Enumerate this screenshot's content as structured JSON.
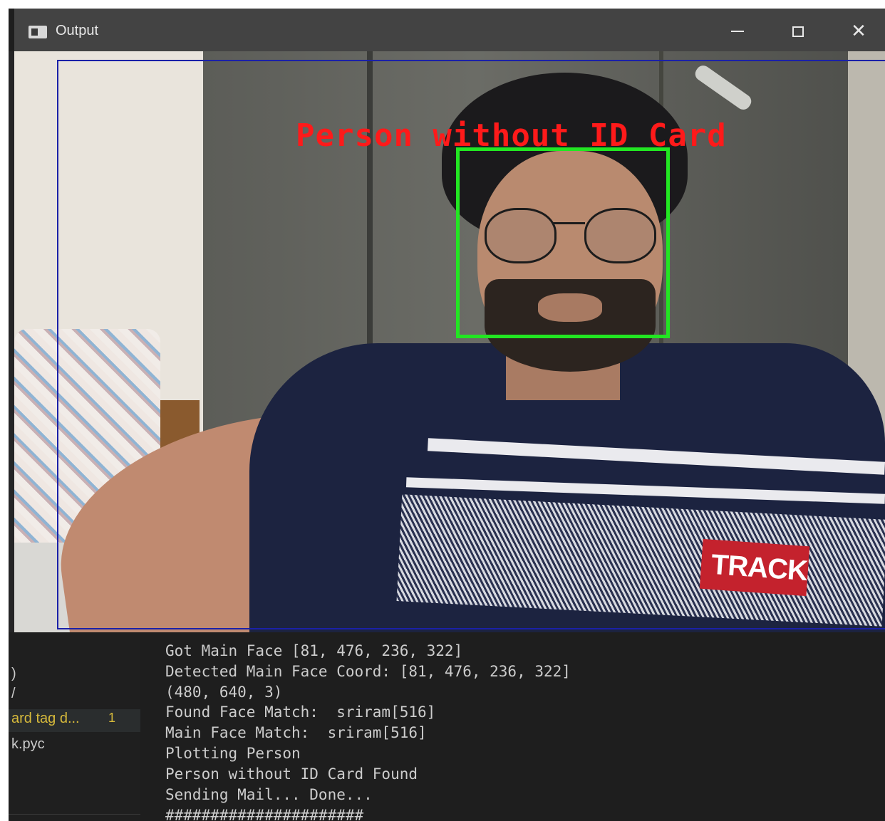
{
  "window": {
    "title": "Output",
    "controls": {
      "minimize": "minimize",
      "maximize": "maximize",
      "close": "✕"
    }
  },
  "detection": {
    "label": "Person without ID Card",
    "colors": {
      "label": "#ff1a1a",
      "face_box": "#22e622",
      "body_box": "#1a20a8"
    }
  },
  "scene": {
    "shirt_logo_text": "TRACK"
  },
  "sidebar": {
    "items": [
      {
        "label": ")"
      },
      {
        "label": "/"
      },
      {
        "label": "ard tag d...",
        "badge": "1",
        "active": true
      },
      {
        "label": "k.pyc"
      }
    ]
  },
  "terminal": {
    "lines": [
      "Got Main Face [81, 476, 236, 322]",
      "Detected Main Face Coord: [81, 476, 236, 322]",
      "(480, 640, 3)",
      "Found Face Match:  sriram[516]",
      "Main Face Match:  sriram[516]",
      "Plotting Person",
      "Person without ID Card Found",
      "Sending Mail... Done...",
      "######################"
    ]
  }
}
